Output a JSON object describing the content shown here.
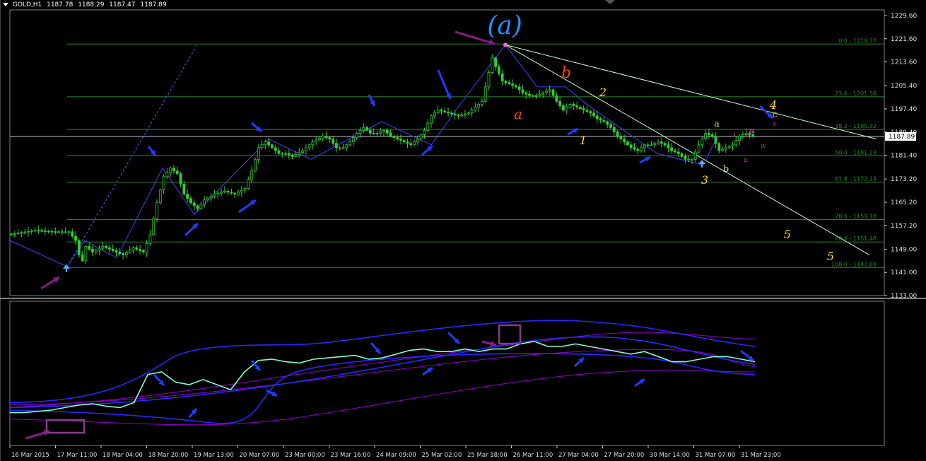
{
  "header": {
    "symbol": "GOLD,H1",
    "open": "1187.78",
    "high": "1188.29",
    "low": "1187.47",
    "close": "1187.89"
  },
  "colors": {
    "background": "#000000",
    "candle": "#32cd32",
    "grid_line": "#2e8b2e",
    "fib_text": "#228b22",
    "zigzag": "#4040ff",
    "arrow": "#1e3cff",
    "purple_arrow": "#8b1a8b",
    "wave_label_yellow": "#ffd700",
    "wave_label_orange": "#ff4500",
    "wave_label_cyan": "#1e90ff",
    "indicator_line": "#7fffd4",
    "band_blue": "#2828ff",
    "band_purple": "#9400d3"
  },
  "chart_data": [
    {
      "type": "candlestick",
      "title": "",
      "price_axis_ticks": [
        "1229.60",
        "1221.60",
        "1213.60",
        "1205.40",
        "1197.40",
        "1189.40",
        "1181.40",
        "1173.20",
        "1165.20",
        "1157.20",
        "1149.00",
        "1141.00",
        "1133.00"
      ],
      "ylim": [
        1133.0,
        1229.6
      ],
      "current_price": "1187.89",
      "fibonacci_levels": [
        {
          "label": "0.0 - 1219.77",
          "value": 1219.77
        },
        {
          "label": "23.6 - 1201.58",
          "value": 1201.58
        },
        {
          "label": "38.2 - 1190.32",
          "value": 1190.32
        },
        {
          "label": "50.0 - 1181.23",
          "value": 1181.23
        },
        {
          "label": "61.8 - 1172.13",
          "value": 1172.13
        },
        {
          "label": "78.6 - 1159.18",
          "value": 1159.18
        },
        {
          "label": "88.6 - 1151.48",
          "value": 1151.48
        },
        {
          "label": "100.0 - 1142.69",
          "value": 1142.69
        }
      ],
      "x_tick_labels": [
        "16 Mar 2015",
        "17 Mar 11:00",
        "18 Mar 04:00",
        "18 Mar 20:00",
        "19 Mar 13:00",
        "20 Mar 07:00",
        "23 Mar 00:00",
        "23 Mar 16:00",
        "24 Mar 09:00",
        "25 Mar 02:00",
        "25 Mar 18:00",
        "26 Mar 11:00",
        "27 Mar 04:00",
        "27 Mar 20:00",
        "30 Mar 14:00",
        "31 Mar 07:00",
        "31 Mar 23:00"
      ],
      "price_path": [
        [
          0,
          1154
        ],
        [
          8,
          1155.5
        ],
        [
          14,
          1155
        ],
        [
          18,
          1155
        ],
        [
          20,
          1152
        ],
        [
          21,
          1147
        ],
        [
          22,
          1145
        ],
        [
          23,
          1150
        ],
        [
          25,
          1148
        ],
        [
          28,
          1150
        ],
        [
          31,
          1148.5
        ],
        [
          34,
          1147
        ],
        [
          37,
          1149.5
        ],
        [
          40,
          1148
        ],
        [
          42,
          1154
        ],
        [
          44,
          1165
        ],
        [
          46,
          1174
        ],
        [
          48,
          1177
        ],
        [
          50,
          1175
        ],
        [
          52,
          1168
        ],
        [
          54,
          1165
        ],
        [
          56,
          1163
        ],
        [
          58,
          1166
        ],
        [
          61,
          1168
        ],
        [
          64,
          1169
        ],
        [
          67,
          1168
        ],
        [
          70,
          1170
        ],
        [
          72,
          1176
        ],
        [
          74,
          1184
        ],
        [
          76,
          1186
        ],
        [
          78,
          1184
        ],
        [
          80,
          1182
        ],
        [
          82,
          1182
        ],
        [
          84,
          1181
        ],
        [
          87,
          1183
        ],
        [
          90,
          1186
        ],
        [
          93,
          1188
        ],
        [
          95,
          1187
        ],
        [
          97,
          1184
        ],
        [
          99,
          1184
        ],
        [
          101,
          1186
        ],
        [
          103,
          1189
        ],
        [
          105,
          1191
        ],
        [
          107,
          1189
        ],
        [
          109,
          1189
        ],
        [
          111,
          1190
        ],
        [
          113,
          1188
        ],
        [
          115,
          1187
        ],
        [
          117,
          1186
        ],
        [
          119,
          1185
        ],
        [
          121,
          1187
        ],
        [
          123,
          1190
        ],
        [
          125,
          1195
        ],
        [
          127,
          1197
        ],
        [
          130,
          1196
        ],
        [
          133,
          1195
        ],
        [
          136,
          1196
        ],
        [
          138,
          1198
        ],
        [
          140,
          1200
        ],
        [
          141,
          1205
        ],
        [
          142,
          1210
        ],
        [
          143,
          1215
        ],
        [
          144,
          1212
        ],
        [
          146,
          1207
        ],
        [
          148,
          1206
        ],
        [
          150,
          1205
        ],
        [
          152,
          1203
        ],
        [
          154,
          1202
        ],
        [
          156,
          1202
        ],
        [
          158,
          1203
        ],
        [
          160,
          1204
        ],
        [
          162,
          1200
        ],
        [
          164,
          1197
        ],
        [
          166,
          1199
        ],
        [
          168,
          1198
        ],
        [
          170,
          1197
        ],
        [
          172,
          1196
        ],
        [
          174,
          1194
        ],
        [
          176,
          1193
        ],
        [
          178,
          1191
        ],
        [
          180,
          1188
        ],
        [
          182,
          1186
        ],
        [
          184,
          1184
        ],
        [
          186,
          1183
        ],
        [
          188,
          1185
        ],
        [
          190,
          1185
        ],
        [
          192,
          1186
        ],
        [
          194,
          1185
        ],
        [
          196,
          1183
        ],
        [
          198,
          1182
        ],
        [
          200,
          1180
        ],
        [
          202,
          1180
        ],
        [
          204,
          1185
        ],
        [
          206,
          1189
        ],
        [
          208,
          1188
        ],
        [
          210,
          1183
        ],
        [
          212,
          1184
        ],
        [
          214,
          1185
        ],
        [
          216,
          1188
        ],
        [
          218,
          1189
        ],
        [
          220,
          1188
        ]
      ],
      "wave_labels": [
        {
          "text": "(a)",
          "color": "cyan"
        },
        {
          "text": "a",
          "color": "orange"
        },
        {
          "text": "b",
          "color": "orange"
        },
        {
          "text": "1",
          "color": "yellow"
        },
        {
          "text": "2",
          "color": "yellow"
        },
        {
          "text": "3",
          "color": "yellow"
        },
        {
          "text": "4",
          "color": "yellow"
        },
        {
          "text": "5",
          "color": "yellow"
        },
        {
          "text": "5",
          "color": "yellow"
        },
        {
          "text": "a",
          "color": "light-green"
        },
        {
          "text": "b",
          "color": "light-green"
        },
        {
          "text": "c",
          "color": "light-green"
        },
        {
          "text": "i",
          "color": "magenta"
        },
        {
          "text": "ii",
          "color": "magenta"
        },
        {
          "text": "iii",
          "color": "magenta"
        },
        {
          "text": "iv",
          "color": "magenta"
        },
        {
          "text": "v",
          "color": "magenta"
        }
      ]
    },
    {
      "type": "line",
      "title": "",
      "series": [
        {
          "values": [
            0.82,
            0.82,
            0.81,
            0.8,
            0.78,
            0.76,
            0.75,
            0.77,
            0.78,
            0.74,
            0.52,
            0.5,
            0.58,
            0.6,
            0.56,
            0.6,
            0.64,
            0.5,
            0.41,
            0.4,
            0.42,
            0.43,
            0.4,
            0.39,
            0.38,
            0.37,
            0.4,
            0.39,
            0.36,
            0.33,
            0.32,
            0.34,
            0.34,
            0.32,
            0.34,
            0.32,
            0.32,
            0.28,
            0.26,
            0.3,
            0.3,
            0.28,
            0.3,
            0.32,
            0.34,
            0.36,
            0.34,
            0.38,
            0.42,
            0.42,
            0.4,
            0.38,
            0.38,
            0.4,
            0.42
          ]
        }
      ]
    }
  ]
}
